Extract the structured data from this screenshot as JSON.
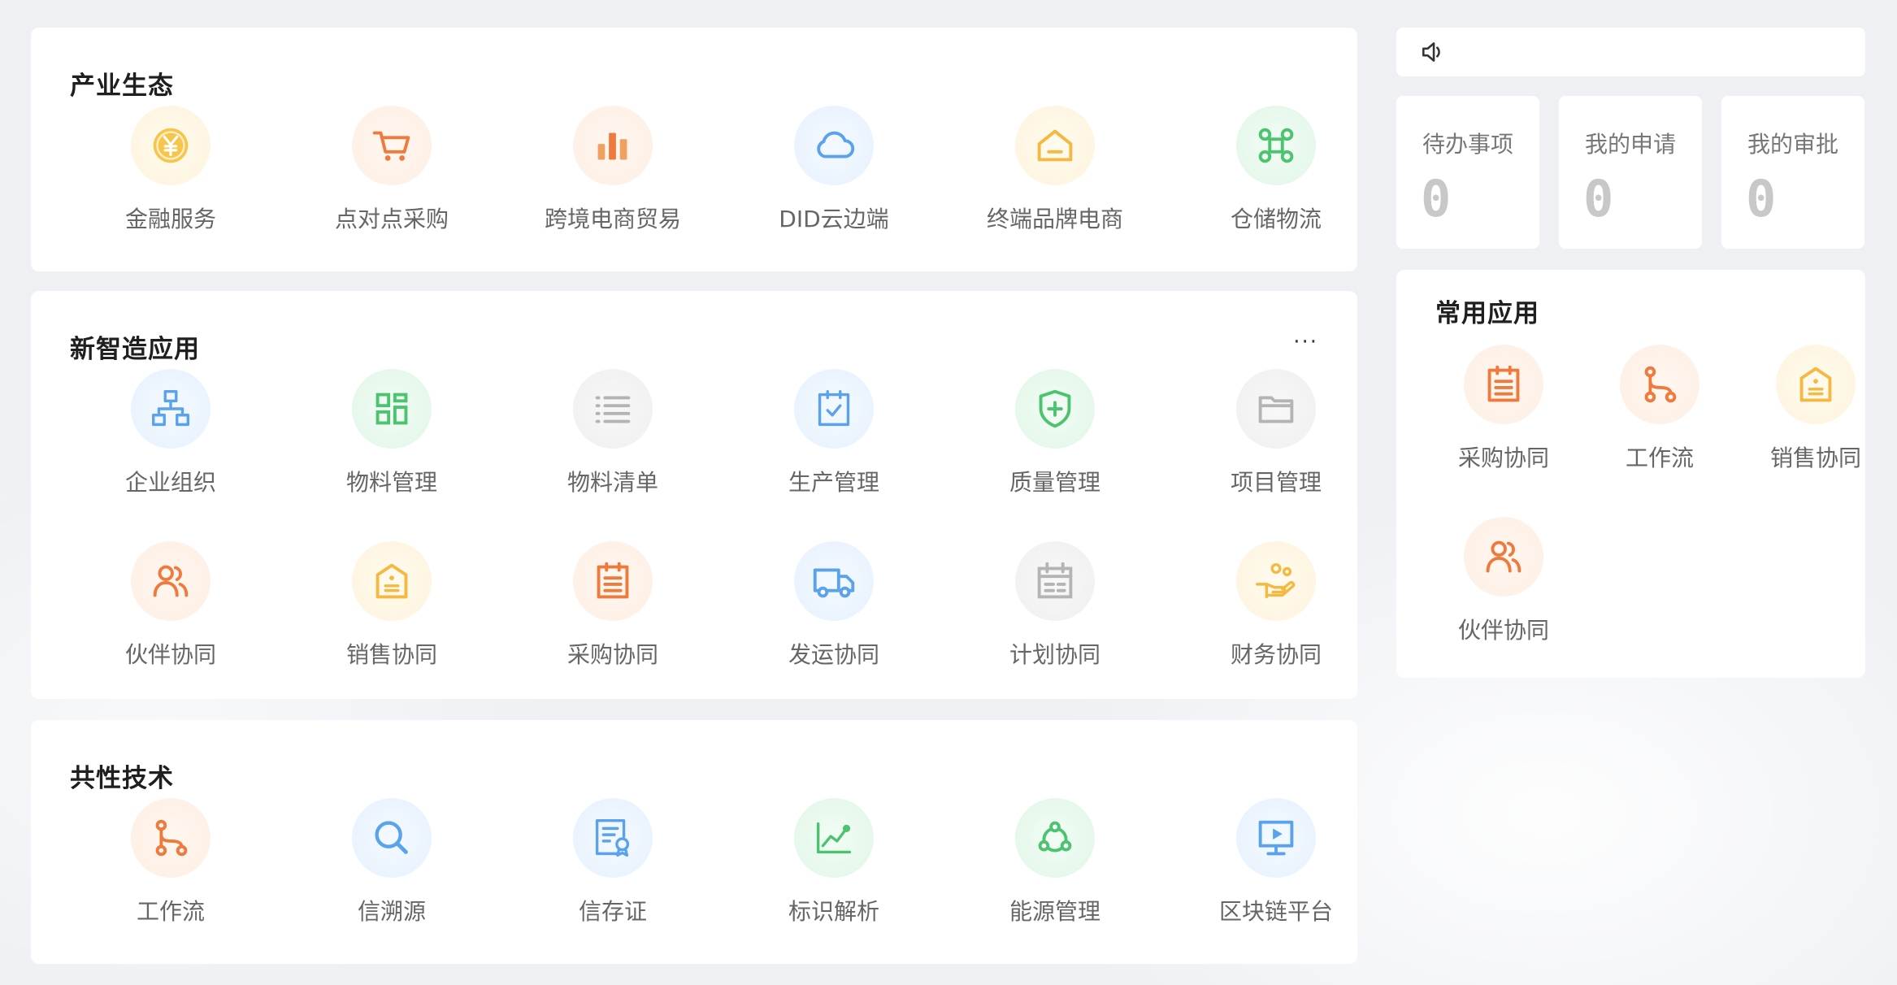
{
  "industry": {
    "title": "产业生态",
    "items": [
      {
        "label": "金融服务",
        "icon": "yuan-coin-icon"
      },
      {
        "label": "点对点采购",
        "icon": "shopping-cart-icon"
      },
      {
        "label": "跨境电商贸易",
        "icon": "bar-chart-icon"
      },
      {
        "label": "DID云边端",
        "icon": "cloud-icon"
      },
      {
        "label": "终端品牌电商",
        "icon": "home-icon"
      },
      {
        "label": "仓储物流",
        "icon": "command-key-icon"
      }
    ]
  },
  "smart": {
    "title": "新智造应用",
    "more": "···",
    "items": [
      {
        "label": "企业组织",
        "icon": "org-chart-icon"
      },
      {
        "label": "物料管理",
        "icon": "grid-blocks-icon"
      },
      {
        "label": "物料清单",
        "icon": "list-icon"
      },
      {
        "label": "生产管理",
        "icon": "clipboard-check-icon"
      },
      {
        "label": "质量管理",
        "icon": "shield-plus-icon"
      },
      {
        "label": "项目管理",
        "icon": "folder-icon"
      },
      {
        "label": "伙伴协同",
        "icon": "users-icon"
      },
      {
        "label": "销售协同",
        "icon": "tag-icon"
      },
      {
        "label": "采购协同",
        "icon": "clipboard-icon"
      },
      {
        "label": "发运协同",
        "icon": "truck-icon"
      },
      {
        "label": "计划协同",
        "icon": "calendar-icon"
      },
      {
        "label": "财务协同",
        "icon": "hand-coins-icon"
      }
    ]
  },
  "tech": {
    "title": "共性技术",
    "items": [
      {
        "label": "工作流",
        "icon": "workflow-icon"
      },
      {
        "label": "信溯源",
        "icon": "search-icon"
      },
      {
        "label": "信存证",
        "icon": "certificate-icon"
      },
      {
        "label": "标识解析",
        "icon": "trend-chart-icon"
      },
      {
        "label": "能源管理",
        "icon": "network-icon"
      },
      {
        "label": "区块链平台",
        "icon": "presentation-icon"
      }
    ]
  },
  "notice": {
    "icon": "speaker-icon"
  },
  "stats": [
    {
      "label": "待办事项",
      "value": "0"
    },
    {
      "label": "我的申请",
      "value": "0"
    },
    {
      "label": "我的审批",
      "value": "0"
    }
  ],
  "common": {
    "title": "常用应用",
    "items": [
      {
        "label": "采购协同",
        "icon": "clipboard-icon"
      },
      {
        "label": "工作流",
        "icon": "workflow-icon"
      },
      {
        "label": "销售协同",
        "icon": "tag-icon"
      },
      {
        "label": "伙伴协同",
        "icon": "users-icon"
      }
    ]
  },
  "colors": {
    "orange": "#ef7a3d",
    "yellow": "#f5b841",
    "blue": "#5aa3ec",
    "green": "#4cc36f",
    "gray": "#b4b4b4",
    "background": "#eef0f4"
  }
}
